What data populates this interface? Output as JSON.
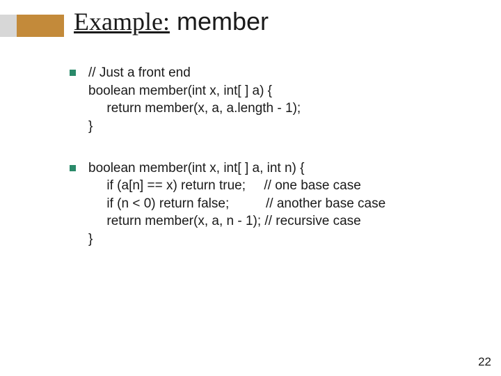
{
  "title": {
    "part_underlined": "Example:",
    "part_plain": " member"
  },
  "block1": {
    "l1": "// Just a front end",
    "l2": "boolean member(int x, int[ ] a) {",
    "l3": "     return member(x, a, a.length - 1);",
    "l4": "}"
  },
  "block2": {
    "l1": "boolean member(int x, int[ ] a, int n) {",
    "l2": "     if (a[n] == x) return true;     // one base case",
    "l3": "     if (n < 0) return false;          // another base case",
    "l4": "     return member(x, a, n - 1); // recursive case",
    "l5": "}"
  },
  "page_number": "22",
  "colors": {
    "bullet_green": "#2a8a6a",
    "bar_brown": "#c38a3a",
    "bar_gray": "#d7d7d7"
  }
}
